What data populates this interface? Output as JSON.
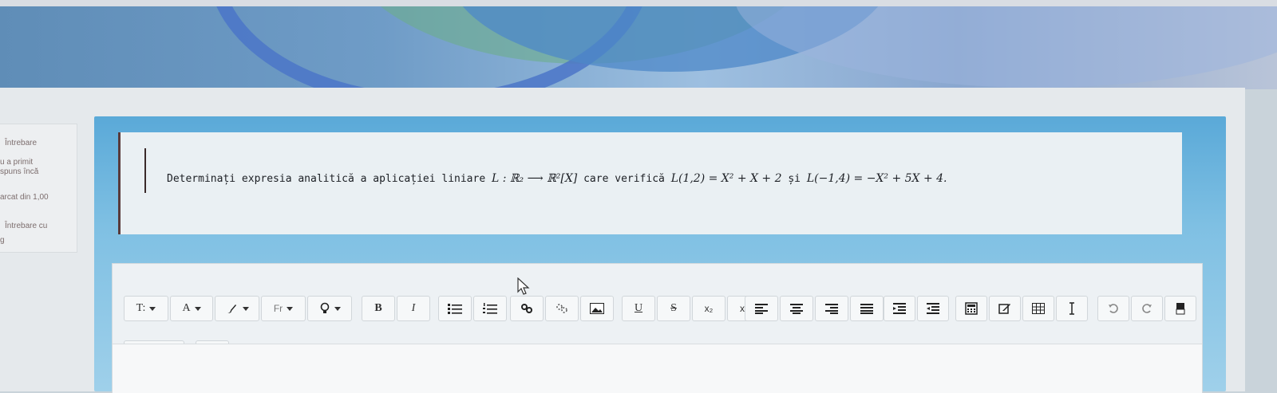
{
  "sidebar_info": {
    "line1": "Întrebare",
    "line2": "u a primit",
    "line3": "spuns încă",
    "line4": "arcat din 1,00",
    "line5": "Întrebare cu",
    "line6": "g"
  },
  "question": {
    "prefix": "Determinați expresia analitică a aplicației liniare",
    "map": "L : ℝ₂ ⟶ ℝ²[X]",
    "middle": "care verifică",
    "cond1": "L(1,2) = X² + X + 2",
    "conj": "și",
    "cond2": "L(−1,4) = −X² + 5X + 4."
  },
  "toolbar": {
    "paragraph": "T:",
    "font_color": "A",
    "font_family": "Fr",
    "bold": "B",
    "italic": "I",
    "underline": "U",
    "strike": "S",
    "subscript": "x₂",
    "superscript": "x²",
    "html": "</>"
  },
  "icons": {
    "paragraph": "paragraph-style-icon",
    "font_color": "font-color-icon",
    "brush": "brush-icon",
    "font_family": "font-family-icon",
    "lightbulb": "lightbulb-icon",
    "ul": "unordered-list-icon",
    "ol": "ordered-list-icon",
    "link": "link-icon",
    "unlink": "unlink-icon",
    "image": "image-icon",
    "align_left": "align-left-icon",
    "align_center": "align-center-icon",
    "align_right": "align-right-icon",
    "align_justify": "align-justify-icon",
    "outdent": "outdent-icon",
    "indent": "indent-icon",
    "calculator": "equation-icon",
    "edit": "edit-icon",
    "table": "table-icon",
    "cursor": "text-cursor-icon",
    "undo": "undo-icon",
    "redo": "redo-icon",
    "clear": "clear-format-icon",
    "accessibility": "accessibility-icon",
    "dots": "more-dots-icon",
    "code": "html-code-icon"
  }
}
